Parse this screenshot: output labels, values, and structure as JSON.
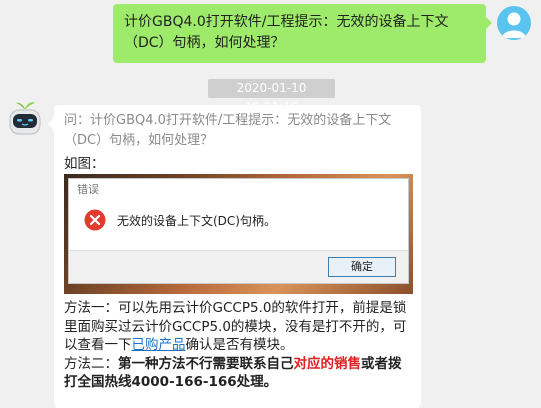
{
  "user_message": {
    "text": "计价GBQ4.0打开软件/工程提示：无效的设备上下文（DC）句柄，如何处理？",
    "avatar_icon": "user-avatar-icon",
    "bubble_color": "#9eea6a"
  },
  "timestamp": "2020-01-10 18:21:16",
  "bot_message": {
    "avatar_icon": "robot-avatar-icon",
    "question": "问：计价GBQ4.0打开软件/工程提示：无效的设备上下文（DC）句柄，如何处理？",
    "figure_label": "如图：",
    "error_dialog": {
      "title": "错误",
      "message": "无效的设备上下文(DC)句柄。",
      "ok_button": "确定",
      "icon": "error-x-icon"
    },
    "method1": {
      "text_before_link": "方法一：可以先用云计价GCCP5.0的软件打开，前提是锁里面购买过云计价GCCP5.0的模块，没有是打不开的，可以查看一下",
      "link_text": "已购产品",
      "text_after_link": "确认是否有模块。"
    },
    "method2": {
      "prefix": "方法二：",
      "bold_before": "第一种方法不行需要联系自己",
      "red_text": "对应的销售",
      "bold_after": "或者拨打全国热线4000-166-166处理。"
    }
  },
  "colors": {
    "background": "#f0f0f0",
    "link": "#1a73c9",
    "highlight_red": "#e02020"
  }
}
